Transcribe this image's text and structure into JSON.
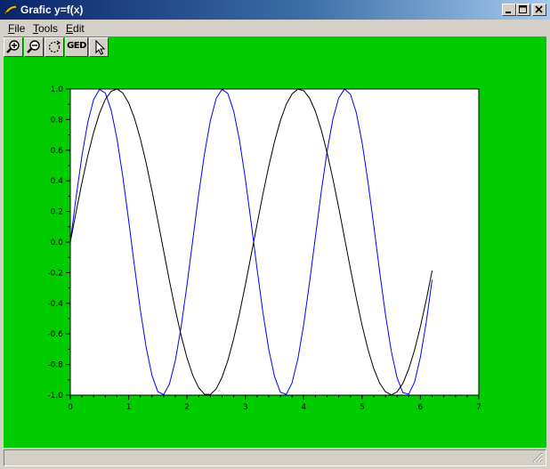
{
  "window": {
    "title": "Grafic y=f(x)",
    "title_icon": "scilab-icon",
    "controls": [
      "minimize-icon",
      "maximize-icon",
      "close-icon"
    ]
  },
  "menu": [
    {
      "label": "File",
      "mnemonic": "F",
      "rest": "ile"
    },
    {
      "label": "Tools",
      "mnemonic": "T",
      "rest": "ools"
    },
    {
      "label": "Edit",
      "mnemonic": "E",
      "rest": "dit"
    }
  ],
  "toolbar": {
    "buttons": [
      {
        "icon": "zoom-in-icon"
      },
      {
        "icon": "zoom-out-icon"
      },
      {
        "icon": "rotate-icon"
      },
      {
        "label": "GED"
      },
      {
        "icon": "pointer-icon"
      }
    ]
  },
  "colors": {
    "figure_background": "#00cc00",
    "axes_background": "#ffffff",
    "series_1": "#0000ff",
    "series_2": "#000000"
  },
  "chart_data": {
    "type": "line",
    "xlim": [
      0,
      7
    ],
    "ylim": [
      -1,
      1
    ],
    "xticks": [
      0,
      1,
      2,
      3,
      4,
      5,
      6,
      7
    ],
    "xtick_labels": [
      "0",
      "1",
      "2",
      "3",
      "4",
      "5",
      "6",
      "7"
    ],
    "yticks": [
      -1.0,
      -0.8,
      -0.6,
      -0.4,
      -0.2,
      0.0,
      0.2,
      0.4,
      0.6,
      0.8,
      1.0
    ],
    "ytick_labels": [
      "-1.0",
      "-0.8",
      "-0.6",
      "-0.4",
      "-0.2",
      "0.0",
      "0.2",
      "0.4",
      "0.6",
      "0.8",
      "1.0"
    ],
    "grid": false,
    "series": [
      {
        "color": "#0000ff",
        "x_step": 0.1,
        "x_range": [
          0,
          6.2
        ],
        "y": [
          0.0,
          0.296,
          0.565,
          0.783,
          0.932,
          0.997,
          0.974,
          0.863,
          0.675,
          0.427,
          0.141,
          -0.158,
          -0.443,
          -0.688,
          -0.872,
          -0.978,
          -0.996,
          -0.926,
          -0.773,
          -0.551,
          -0.279,
          0.017,
          0.312,
          0.578,
          0.793,
          0.938,
          0.998,
          0.97,
          0.855,
          0.663,
          0.412,
          0.124,
          -0.175,
          -0.458,
          -0.7,
          -0.879,
          -0.981,
          -0.995,
          -0.92,
          -0.762,
          -0.537,
          -0.263,
          0.033,
          0.328,
          0.592,
          0.803,
          0.943,
          0.999,
          0.966,
          0.847,
          0.65,
          0.396,
          0.108,
          -0.191,
          -0.472,
          -0.712,
          -0.887,
          -0.984,
          -0.993,
          -0.914,
          -0.75,
          -0.522,
          -0.247
        ]
      },
      {
        "color": "#000000",
        "x_step": 0.1,
        "x_range": [
          0,
          6.2
        ],
        "y": [
          0.0,
          0.198,
          0.389,
          0.565,
          0.717,
          0.841,
          0.932,
          0.985,
          1.0,
          0.974,
          0.909,
          0.808,
          0.675,
          0.516,
          0.335,
          0.141,
          -0.058,
          -0.256,
          -0.443,
          -0.612,
          -0.757,
          -0.872,
          -0.952,
          -0.994,
          -0.996,
          -0.959,
          -0.883,
          -0.773,
          -0.631,
          -0.465,
          -0.279,
          -0.083,
          0.116,
          0.312,
          0.494,
          0.657,
          0.794,
          0.899,
          0.968,
          0.999,
          0.989,
          0.94,
          0.854,
          0.733,
          0.584,
          0.412,
          0.224,
          0.025,
          -0.174,
          -0.366,
          -0.544,
          -0.7,
          -0.827,
          -0.921,
          -0.978,
          -0.998,
          -0.979,
          -0.922,
          -0.829,
          -0.704,
          -0.551,
          -0.378,
          -0.187
        ]
      }
    ]
  }
}
